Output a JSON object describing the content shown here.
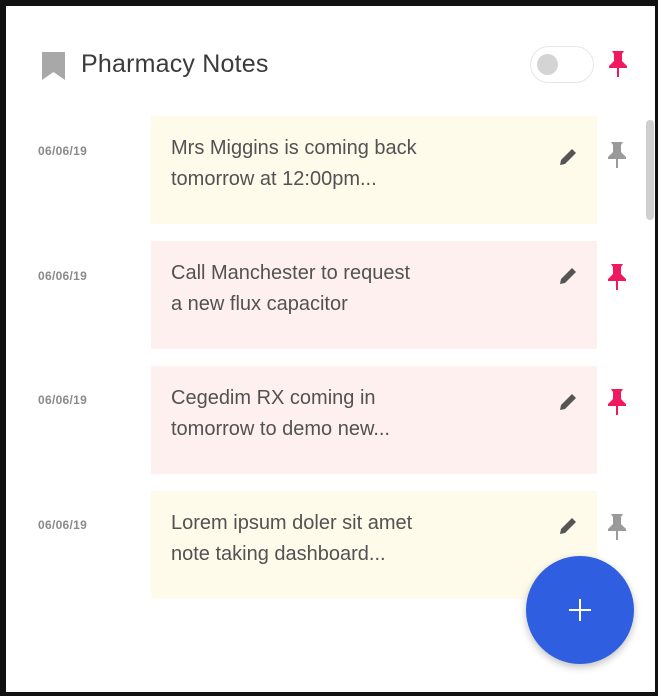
{
  "header": {
    "title": "Pharmacy Notes",
    "toggle_on": false,
    "pin_color": "#f0185e"
  },
  "colors": {
    "accent_pin": "#f0185e",
    "inactive_pin": "#9a9a9a",
    "yellow_card": "#fffbeb",
    "pink_card": "#fff0f0",
    "fab": "#2f5fe0"
  },
  "notes": [
    {
      "date": "06/06/19",
      "line1": "Mrs Miggins is coming back",
      "line2": "tomorrow at 12:00pm...",
      "color": "yellow",
      "pinned": false
    },
    {
      "date": "06/06/19",
      "line1": "Call Manchester to request",
      "line2": "a new flux capacitor",
      "color": "pink",
      "pinned": true
    },
    {
      "date": "06/06/19",
      "line1": "Cegedim RX coming in",
      "line2": "tomorrow to demo new...",
      "color": "pink",
      "pinned": true
    },
    {
      "date": "06/06/19",
      "line1": "Lorem ipsum doler sit amet",
      "line2": "note taking dashboard...",
      "color": "yellow",
      "pinned": false
    }
  ],
  "fab": {
    "icon": "plus-icon"
  }
}
